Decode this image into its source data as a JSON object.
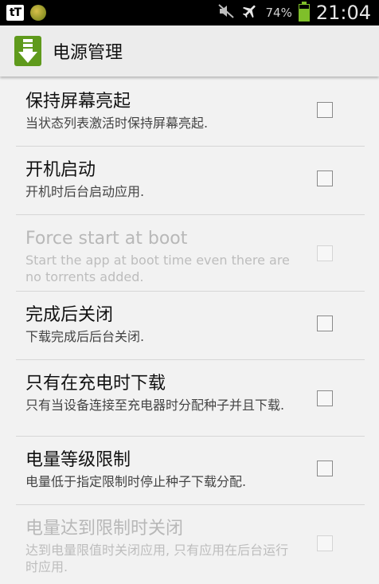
{
  "status_bar": {
    "left_icons": [
      "tt-icon",
      "coin-icon"
    ],
    "icons": [
      "mute-icon",
      "airplane-icon",
      "battery-icon"
    ],
    "battery_percent": "74%",
    "battery_level": 0.74,
    "time": "21:04"
  },
  "action_bar": {
    "title": "电源管理",
    "icon": "download-app-icon",
    "accent": "#5f9a1c"
  },
  "settings": [
    {
      "title": "保持屏幕亮起",
      "summary": "当状态列表激活时保持屏幕亮起.",
      "enabled": true,
      "checked": false
    },
    {
      "title": "开机启动",
      "summary": "开机时后台启动应用.",
      "enabled": true,
      "checked": false
    },
    {
      "title": "Force start at boot",
      "summary": "Start the app at boot time even there are no torrents added.",
      "enabled": false,
      "checked": false
    },
    {
      "title": "完成后关闭",
      "summary": "下载完成后后台关闭.",
      "enabled": true,
      "checked": false
    },
    {
      "title": "只有在充电时下载",
      "summary": "只有当设备连接至充电器时分配种子并且下载.",
      "enabled": true,
      "checked": false
    },
    {
      "title": "电量等级限制",
      "summary": "电量低于指定限制时停止种子下载分配.",
      "enabled": true,
      "checked": false
    },
    {
      "title": "电量达到限制时关闭",
      "summary": "达到电量限值时关闭应用, 只有应用在后台运行时应用.",
      "enabled": false,
      "checked": false
    }
  ]
}
